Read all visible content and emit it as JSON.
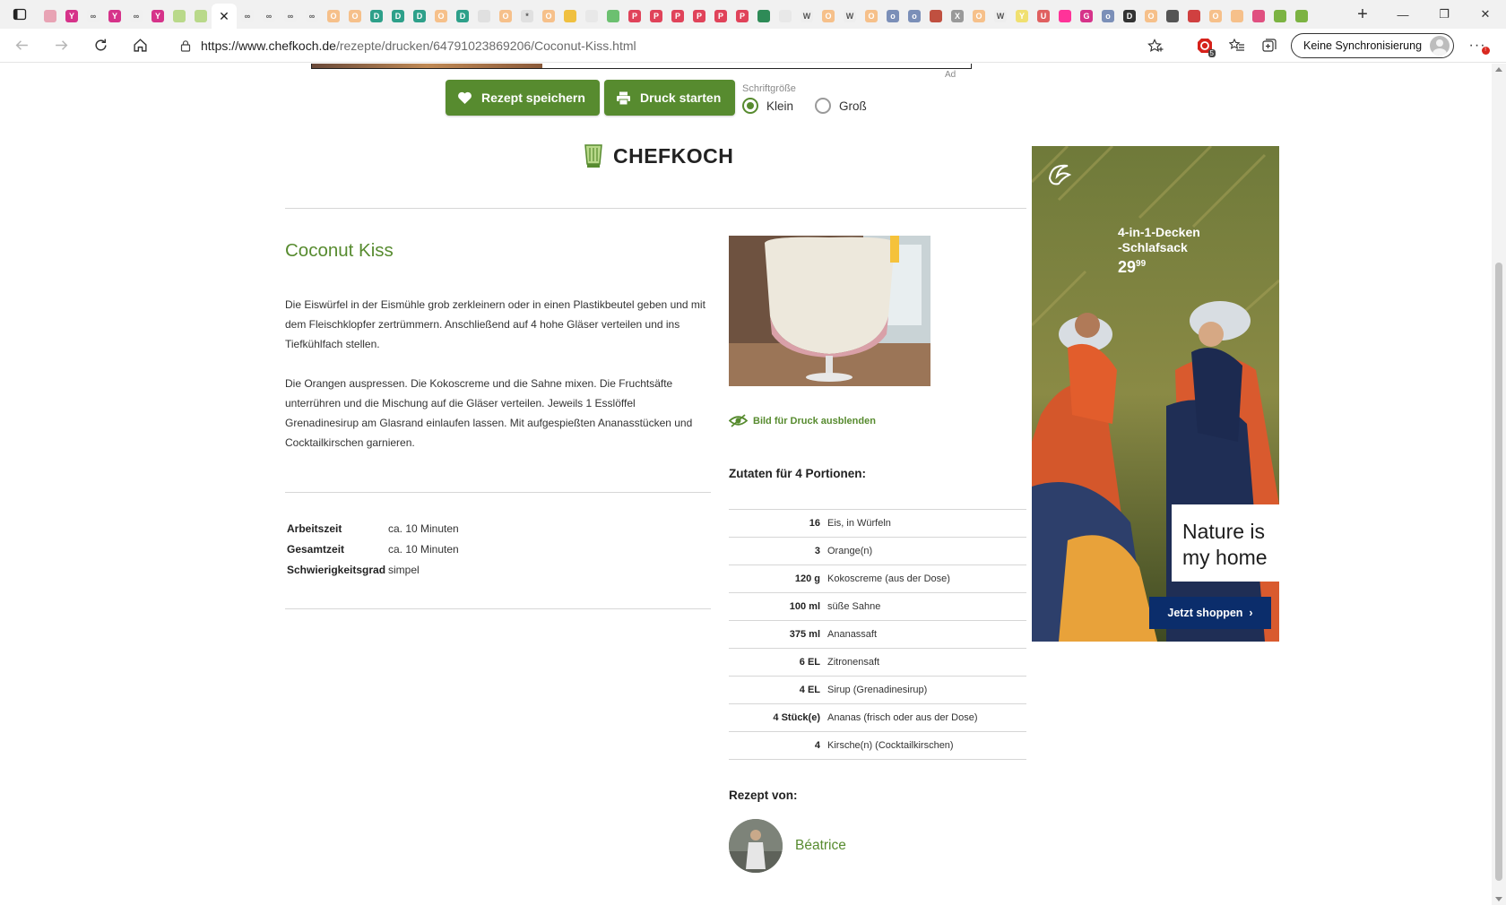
{
  "browser": {
    "url_host": "https://www.chefkoch.de",
    "url_path": "/rezepte/drucken/64791023869206/Coconut-Kiss.html",
    "sync_label": "Keine Synchronisierung",
    "extension_badge": "5",
    "tab_favicons": [
      {
        "color": "#e8a3b4",
        "glyph": ""
      },
      {
        "color": "#d6338a",
        "glyph": "Y"
      },
      {
        "color": "#f0f0f0",
        "glyph": "∞"
      },
      {
        "color": "#d6338a",
        "glyph": "Y"
      },
      {
        "color": "#f0f0f0",
        "glyph": "∞"
      },
      {
        "color": "#d6338a",
        "glyph": "Y"
      },
      {
        "color": "#b9d98a",
        "glyph": ""
      },
      {
        "color": "#b9d98a",
        "glyph": ""
      },
      {
        "color": "#f0f0f0",
        "glyph": "∞"
      },
      {
        "color": "#f0f0f0",
        "glyph": "∞"
      },
      {
        "color": "#f0f0f0",
        "glyph": "∞"
      },
      {
        "color": "#f0f0f0",
        "glyph": "∞"
      },
      {
        "color": "#f6c08a",
        "glyph": "O"
      },
      {
        "color": "#f6c08a",
        "glyph": "O"
      },
      {
        "color": "#2ea08a",
        "glyph": "D"
      },
      {
        "color": "#2ea08a",
        "glyph": "D"
      },
      {
        "color": "#2ea08a",
        "glyph": "D"
      },
      {
        "color": "#f6c08a",
        "glyph": "O"
      },
      {
        "color": "#2ea08a",
        "glyph": "D"
      },
      {
        "color": "#e0e0e0",
        "glyph": ""
      },
      {
        "color": "#f6c08a",
        "glyph": "O"
      },
      {
        "color": "#e0e0e0",
        "glyph": "*"
      },
      {
        "color": "#f6c08a",
        "glyph": "O"
      },
      {
        "color": "#f0c040",
        "glyph": ""
      },
      {
        "color": "#e8e8e8",
        "glyph": ""
      },
      {
        "color": "#6cc070",
        "glyph": ""
      },
      {
        "color": "#e0435a",
        "glyph": "P"
      },
      {
        "color": "#e0435a",
        "glyph": "P"
      },
      {
        "color": "#e0435a",
        "glyph": "P"
      },
      {
        "color": "#e0435a",
        "glyph": "P"
      },
      {
        "color": "#e0435a",
        "glyph": "P"
      },
      {
        "color": "#e0435a",
        "glyph": "P"
      },
      {
        "color": "#2e8b57",
        "glyph": ""
      },
      {
        "color": "#e8e8e8",
        "glyph": ""
      },
      {
        "color": "#eeeeee",
        "glyph": "W"
      },
      {
        "color": "#f6c08a",
        "glyph": "O"
      },
      {
        "color": "#eeeeee",
        "glyph": "W"
      },
      {
        "color": "#f6c08a",
        "glyph": "O"
      },
      {
        "color": "#7b8fb8",
        "glyph": "o"
      },
      {
        "color": "#7b8fb8",
        "glyph": "o"
      },
      {
        "color": "#c05040",
        "glyph": ""
      },
      {
        "color": "#999999",
        "glyph": "X"
      },
      {
        "color": "#f6c08a",
        "glyph": "O"
      },
      {
        "color": "#eeeeee",
        "glyph": "W"
      },
      {
        "color": "#f0e070",
        "glyph": "Y"
      },
      {
        "color": "#e06060",
        "glyph": "U"
      },
      {
        "color": "#ff3399",
        "glyph": ""
      },
      {
        "color": "#d6338a",
        "glyph": "G"
      },
      {
        "color": "#7b8fb8",
        "glyph": "o"
      },
      {
        "color": "#333333",
        "glyph": "D"
      },
      {
        "color": "#f6c08a",
        "glyph": "O"
      },
      {
        "color": "#555555",
        "glyph": ""
      },
      {
        "color": "#d04040",
        "glyph": ""
      },
      {
        "color": "#f6c08a",
        "glyph": "O"
      },
      {
        "color": "#f6c08a",
        "glyph": ""
      },
      {
        "color": "#e05080",
        "glyph": ""
      },
      {
        "color": "#7cb342",
        "glyph": ""
      },
      {
        "color": "#7cb342",
        "glyph": ""
      }
    ]
  },
  "toolbar": {
    "save_label": "Rezept speichern",
    "print_label": "Druck starten",
    "fontsize_label": "Schriftgröße",
    "fontsize_small": "Klein",
    "fontsize_large": "Groß",
    "top_ad_label": "Ad"
  },
  "colors": {
    "brand_green": "#578b2f",
    "ad_navy": "#0b2d6b"
  },
  "logo_text": "CHEFKOCH",
  "recipe": {
    "title": "Coconut Kiss",
    "instructions": [
      "Die Eiswürfel in der Eismühle grob zerkleinern oder in einen Plastikbeutel geben und mit dem Fleischklopfer zertrümmern. Anschließend auf 4 hohe Gläser verteilen und ins Tiefkühlfach stellen.",
      "Die Orangen auspressen. Die Kokoscreme und die Sahne mixen. Die Fruchtsäfte unterrühren und die Mischung auf die Gläser verteilen. Jeweils 1 Esslöffel Grenadinesirup am Glasrand einlaufen lassen. Mit aufgespießten Ananasstücken und Cocktailkirschen garnieren."
    ],
    "times": [
      {
        "label": "Arbeitszeit",
        "value": "ca. 10 Minuten"
      },
      {
        "label": "Gesamtzeit",
        "value": "ca. 10 Minuten"
      },
      {
        "label": "Schwierigkeitsgrad",
        "value": "simpel"
      }
    ],
    "hide_image_label": "Bild für Druck ausblenden",
    "ingredients_heading": "Zutaten für 4 Portionen:",
    "ingredients": [
      {
        "amount": "16",
        "name": "Eis, in Würfeln"
      },
      {
        "amount": "3",
        "name": "Orange(n)"
      },
      {
        "amount": "120 g",
        "name": "Kokoscreme (aus der Dose)"
      },
      {
        "amount": "100 ml",
        "name": "süße Sahne"
      },
      {
        "amount": "375 ml",
        "name": "Ananassaft"
      },
      {
        "amount": "6 EL",
        "name": "Zitronensaft"
      },
      {
        "amount": "4 EL",
        "name": "Sirup (Grenadinesirup)"
      },
      {
        "amount": "4 Stück(e)",
        "name": "Ananas (frisch oder aus der Dose)"
      },
      {
        "amount": "4",
        "name": "Kirsche(n) (Cocktailkirschen)"
      }
    ],
    "author_heading": "Rezept von:",
    "author_name": "Béatrice"
  },
  "side_ad": {
    "headline_line1": "4-in-1-Decken",
    "headline_line2": "-Schlafsack",
    "price_main": "29",
    "price_cents": "99",
    "slogan_line1": "Nature is",
    "slogan_line2": "my home",
    "cta": "Jetzt shoppen"
  }
}
